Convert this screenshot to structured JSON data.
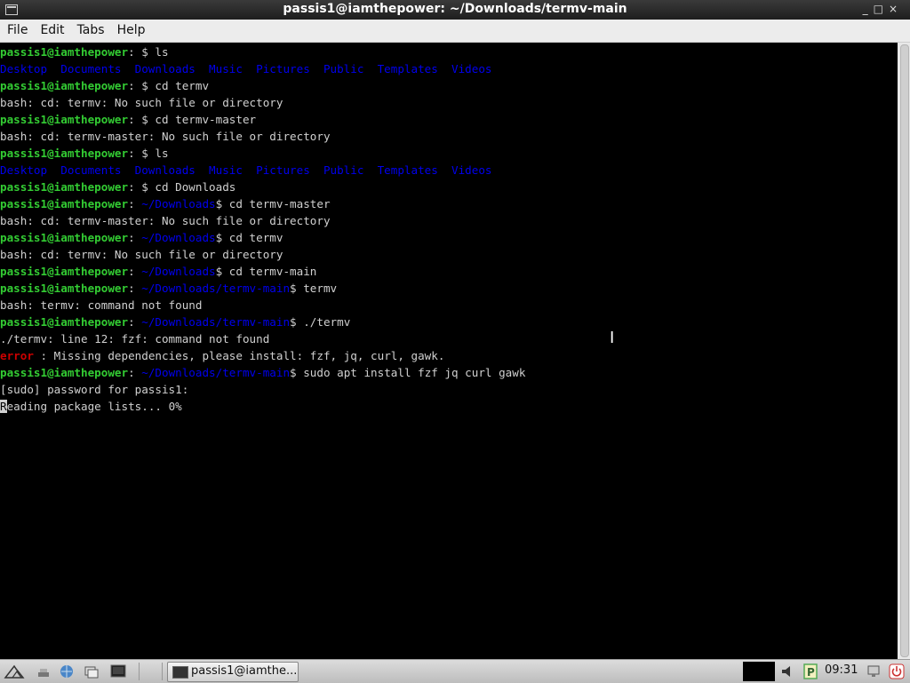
{
  "window": {
    "title": "passis1@iamthepower: ~/Downloads/termv-main",
    "controls": [
      "_",
      "□",
      "×"
    ]
  },
  "menu": [
    "File",
    "Edit",
    "Tabs",
    "Help"
  ],
  "terminal": {
    "lines": [
      {
        "segments": [
          {
            "t": "passis1@iamthepower",
            "c": "u"
          },
          {
            "t": ": $ ls",
            "c": ""
          }
        ]
      },
      {
        "segments": [
          {
            "t": "Desktop  Documents  Downloads  Music  Pictures  Public  Templates  Videos",
            "c": "ls"
          }
        ]
      },
      {
        "segments": [
          {
            "t": "passis1@iamthepower",
            "c": "u"
          },
          {
            "t": ": $ cd termv",
            "c": ""
          }
        ]
      },
      {
        "segments": [
          {
            "t": "bash: cd: termv: No such file or directory",
            "c": ""
          }
        ]
      },
      {
        "segments": [
          {
            "t": "passis1@iamthepower",
            "c": "u"
          },
          {
            "t": ": $ cd termv-master",
            "c": ""
          }
        ]
      },
      {
        "segments": [
          {
            "t": "bash: cd: termv-master: No such file or directory",
            "c": ""
          }
        ]
      },
      {
        "segments": [
          {
            "t": "passis1@iamthepower",
            "c": "u"
          },
          {
            "t": ": $ ls",
            "c": ""
          }
        ]
      },
      {
        "segments": [
          {
            "t": "Desktop  Documents  Downloads  Music  Pictures  Public  Templates  Videos",
            "c": "ls"
          }
        ]
      },
      {
        "segments": [
          {
            "t": "passis1@iamthepower",
            "c": "u"
          },
          {
            "t": ": $ cd Downloads",
            "c": ""
          }
        ]
      },
      {
        "segments": [
          {
            "t": "passis1@iamthepower",
            "c": "u"
          },
          {
            "t": ": ",
            "c": ""
          },
          {
            "t": "~/Downloads",
            "c": "dir"
          },
          {
            "t": "$ cd termv-master",
            "c": ""
          }
        ]
      },
      {
        "segments": [
          {
            "t": "bash: cd: termv-master: No such file or directory",
            "c": ""
          }
        ]
      },
      {
        "segments": [
          {
            "t": "passis1@iamthepower",
            "c": "u"
          },
          {
            "t": ": ",
            "c": ""
          },
          {
            "t": "~/Downloads",
            "c": "dir"
          },
          {
            "t": "$ cd termv",
            "c": ""
          }
        ]
      },
      {
        "segments": [
          {
            "t": "bash: cd: termv: No such file or directory",
            "c": ""
          }
        ]
      },
      {
        "segments": [
          {
            "t": "passis1@iamthepower",
            "c": "u"
          },
          {
            "t": ": ",
            "c": ""
          },
          {
            "t": "~/Downloads",
            "c": "dir"
          },
          {
            "t": "$ cd termv-main",
            "c": ""
          }
        ]
      },
      {
        "segments": [
          {
            "t": "passis1@iamthepower",
            "c": "u"
          },
          {
            "t": ": ",
            "c": ""
          },
          {
            "t": "~/Downloads/termv-main",
            "c": "dir"
          },
          {
            "t": "$ termv",
            "c": ""
          }
        ]
      },
      {
        "segments": [
          {
            "t": "bash: termv: command not found",
            "c": ""
          }
        ]
      },
      {
        "segments": [
          {
            "t": "passis1@iamthepower",
            "c": "u"
          },
          {
            "t": ": ",
            "c": ""
          },
          {
            "t": "~/Downloads/termv-main",
            "c": "dir"
          },
          {
            "t": "$ ./termv",
            "c": ""
          }
        ]
      },
      {
        "segments": [
          {
            "t": "./termv: line 12: fzf: command not found",
            "c": ""
          }
        ]
      },
      {
        "segments": [
          {
            "t": "error",
            "c": "err"
          },
          {
            "t": " : Missing dependencies, please install: fzf, jq, curl, gawk.",
            "c": ""
          }
        ]
      },
      {
        "segments": [
          {
            "t": "passis1@iamthepower",
            "c": "u"
          },
          {
            "t": ": ",
            "c": ""
          },
          {
            "t": "~/Downloads/termv-main",
            "c": "dir"
          },
          {
            "t": "$ sudo apt install fzf jq curl gawk",
            "c": ""
          }
        ]
      },
      {
        "segments": [
          {
            "t": "[sudo] password for passis1:",
            "c": ""
          }
        ]
      },
      {
        "segments": [
          {
            "t": "R",
            "c": "cursor"
          },
          {
            "t": "eading package lists... 0%",
            "c": ""
          }
        ]
      }
    ]
  },
  "taskbar": {
    "task_label": "passis1@iamthe...",
    "clock": "09:31"
  }
}
